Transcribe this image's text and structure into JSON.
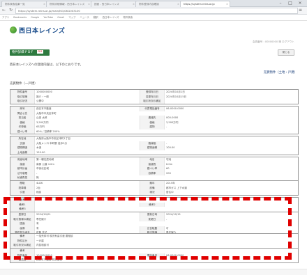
{
  "browser": {
    "tabs": [
      {
        "label": "物件検索結果一覧",
        "active": false
      },
      {
        "label": "物件詳細情報 - 西日本レインズ",
        "active": false
      },
      {
        "label": "図面 - 西日本レインズ",
        "active": false
      },
      {
        "label": "物件登録内容確認",
        "active": false
      },
      {
        "label": "https://system.reins.or.jp",
        "active": true
      }
    ],
    "url": "https://system.reins.or.jp/main/KG/GKG003100",
    "bookmarks": [
      "アプリ",
      "Bookmarks",
      "Google",
      "YouTube",
      "Gmail",
      "マップ",
      "ニュース",
      "翻訳",
      "西日本レインズ",
      "物件検索"
    ]
  },
  "header": {
    "logo_text": "西日本レインズ",
    "right_info": "会員番号 : 00000000 様  ログアウト",
    "close_label": "閉じる"
  },
  "pdf_button": {
    "label": "物件詳細 P D F",
    "icon": "PDF"
  },
  "notice": "西日本レインズへの登録内容は、以下のとおりです。",
  "link_right": "売買物件（土地・戸建）",
  "section_title": "売買物件（一戸建）",
  "tables": [
    {
      "rows": [
        [
          "物件番号",
          "1000000000",
          "登録年月日",
          "2024年10月1日"
        ],
        [
          "取引態様",
          "媒介・一般",
          "変更年月日",
          "2024年10月15日"
        ],
        [
          "取引状況",
          "公開中",
          "取引状況の補足",
          ""
        ]
      ]
    },
    {
      "rows": [
        [
          "商号",
          "西日本不動産",
          "代表電話番号",
          "06-0000-0000"
        ],
        [
          "問合せ先",
          "大阪市中央区本町",
          "",
          ""
        ],
        [
          "担当者",
          "山田 太郎",
          "連絡先",
          "000-0000"
        ],
        [
          "価格",
          "3,500万円",
          "価格",
          "3,500万円"
        ],
        [
          "坪単価",
          "63万円",
          "建物",
          "-"
        ],
        [
          "建ぺい率",
          "60% / 容積率 200%",
          "",
          ""
        ]
      ]
    },
    {
      "rows": [
        [
          "所在地",
          "大阪府大阪市中央区本町1丁目",
          "",
          ""
        ],
        [
          "交通",
          "大阪メトロ 本町駅 徒歩5分",
          "路線価",
          "-"
        ],
        [
          "建物構造",
          "木造",
          "建物面積",
          "100.00"
        ],
        [
          "土地面積",
          "120.00",
          "",
          ""
        ]
      ]
    },
    {
      "rows": [
        [
          "用途地域",
          "第一種住居地域",
          "地目",
          "宅地"
        ],
        [
          "接道",
          "南側 公道 4.0m",
          "接道長",
          "6.0m"
        ],
        [
          "都市計画",
          "市街化区域",
          "建ぺい率",
          "60"
        ],
        [
          "法令制限",
          "-",
          "容積率",
          "200"
        ],
        [
          "私道負担",
          "無",
          "",
          ""
        ]
      ]
    },
    {
      "rows": [
        [
          "間取",
          "4LDK",
          "築年",
          "2015年"
        ],
        [
          "駐車場",
          "2台",
          "設備",
          "都市ガス 上下水道"
        ],
        [
          "引渡",
          "相談",
          "現況",
          "居住中"
        ]
      ]
    },
    {
      "rows": [
        [
          "備考",
          "",
          "",
          ""
        ],
        [
          "備考1",
          "",
          "備考2",
          ""
        ],
        [
          "備考3",
          "",
          "",
          ""
        ]
      ]
    },
    {
      "rows": [
        [
          "登録日",
          "2024/10/01",
          "更新日時",
          "2024/10/15"
        ],
        [
          "取引態様の補足",
          "専任媒介",
          "変更日",
          "-"
        ],
        [
          "図面",
          "有",
          "",
          ""
        ],
        [
          "画像",
          "有",
          "広告転載",
          "可"
        ],
        [
          "物件担当者名",
          "佐藤 花子",
          "取引態様",
          "専任媒介"
        ]
      ]
    },
    {
      "rows": [
        [
          "備考",
          "一括売却可 現況有姿引渡 要相談",
          "",
          ""
        ],
        [
          "物件区分",
          "一戸建",
          "",
          ""
        ],
        [
          "取引状況の補足",
          "内覧相談可",
          "",
          ""
        ]
      ]
    },
    {
      "rows": [
        [
          "備考",
          "",
          "",
          ""
        ],
        [
          "物件番号",
          "1000000000",
          "電話番号",
          "06-0000-0000"
        ],
        [
          "会員名",
          "西日本不動産 株式会社",
          "",
          ""
        ]
      ]
    }
  ]
}
